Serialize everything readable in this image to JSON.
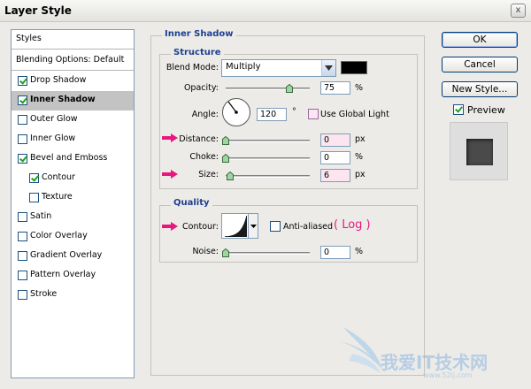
{
  "window": {
    "title": "Layer Style",
    "close_glyph": "x"
  },
  "sidebar": {
    "header": "Styles",
    "blending": "Blending Options: Default",
    "items": [
      {
        "label": "Drop Shadow",
        "checked": true
      },
      {
        "label": "Inner Shadow",
        "checked": true,
        "selected": true
      },
      {
        "label": "Outer Glow",
        "checked": false
      },
      {
        "label": "Inner Glow",
        "checked": false
      },
      {
        "label": "Bevel and Emboss",
        "checked": true
      },
      {
        "label": "Contour",
        "checked": true
      },
      {
        "label": "Texture",
        "checked": false
      },
      {
        "label": "Satin",
        "checked": false
      },
      {
        "label": "Color Overlay",
        "checked": false
      },
      {
        "label": "Gradient Overlay",
        "checked": false
      },
      {
        "label": "Pattern Overlay",
        "checked": false
      },
      {
        "label": "Stroke",
        "checked": false
      }
    ]
  },
  "panel": {
    "title": "Inner Shadow",
    "structure": {
      "title": "Structure",
      "blend_mode_label": "Blend Mode:",
      "blend_mode_value": "Multiply",
      "blend_color": "#000000",
      "opacity_label": "Opacity:",
      "opacity_value": "75",
      "opacity_unit": "%",
      "angle_label": "Angle:",
      "angle_value": "120",
      "angle_unit": "°",
      "global_light_label": "Use Global Light",
      "distance_label": "Distance:",
      "distance_value": "0",
      "distance_unit": "px",
      "choke_label": "Choke:",
      "choke_value": "0",
      "choke_unit": "%",
      "size_label": "Size:",
      "size_value": "6",
      "size_unit": "px"
    },
    "quality": {
      "title": "Quality",
      "contour_label": "Contour:",
      "anti_aliased_label": "Anti-aliased",
      "log_annotation": "( Log )",
      "noise_label": "Noise:",
      "noise_value": "0",
      "noise_unit": "%"
    }
  },
  "buttons": {
    "ok": "OK",
    "cancel": "Cancel",
    "new_style": "New Style...",
    "preview_label": "Preview"
  },
  "colors": {
    "accent_title": "#1d3f93",
    "annotation_pink": "#e8177f",
    "selected_row": "#c3c3c3"
  },
  "watermark": {
    "text": "我爱IT技术网",
    "url": "www.52ij.com"
  }
}
